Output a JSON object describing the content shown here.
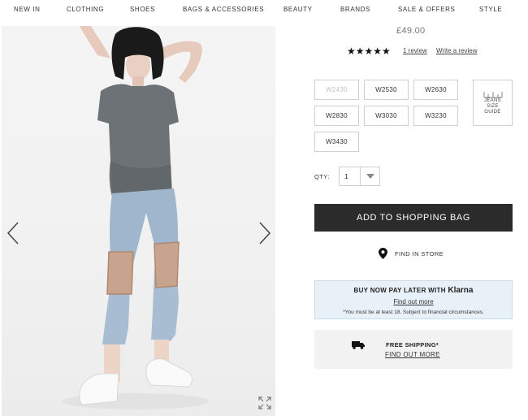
{
  "nav": {
    "items": [
      "NEW IN",
      "CLOTHING",
      "SHOES",
      "BAGS & ACCESSORIES",
      "BEAUTY",
      "BRANDS",
      "SALE & OFFERS",
      "STYLE"
    ]
  },
  "product": {
    "price": "£49.00",
    "rating": 5,
    "stars": "★★★★★",
    "review_count_label": "1 review",
    "write_review_label": "Write a review"
  },
  "sizes": {
    "options": [
      {
        "label": "W2430",
        "available": false
      },
      {
        "label": "W2530",
        "available": true
      },
      {
        "label": "W2630",
        "available": true
      },
      {
        "label": "W2830",
        "available": true
      },
      {
        "label": "W3030",
        "available": true
      },
      {
        "label": "W3230",
        "available": true
      },
      {
        "label": "W3430",
        "available": true
      }
    ],
    "guide_label": "JEANS SIZE GUIDE"
  },
  "quantity": {
    "label": "QTY:",
    "value": "1"
  },
  "actions": {
    "add_to_bag_label": "ADD TO SHOPPING BAG",
    "find_in_store_label": "FIND IN STORE"
  },
  "klarna": {
    "heading": "BUY NOW PAY LATER WITH",
    "brand": "Klarna",
    "link": "Find out more",
    "note": "*You must be at least 18. Subject to financial circumstances."
  },
  "shipping": {
    "title": "FREE SHIPPING*",
    "link": "FIND OUT MORE"
  },
  "icons": {
    "left_arrow": "chevron-left-icon",
    "right_arrow": "chevron-right-icon",
    "expand": "expand-icon",
    "location_pin": "location-pin-icon",
    "truck": "truck-icon",
    "caret": "caret-down-icon",
    "ruler": "ruler-icon"
  },
  "colors": {
    "button_dark": "#2b2b2b",
    "klarna_bg": "#e9f1f8",
    "shipping_bg": "#f2f2f2"
  }
}
